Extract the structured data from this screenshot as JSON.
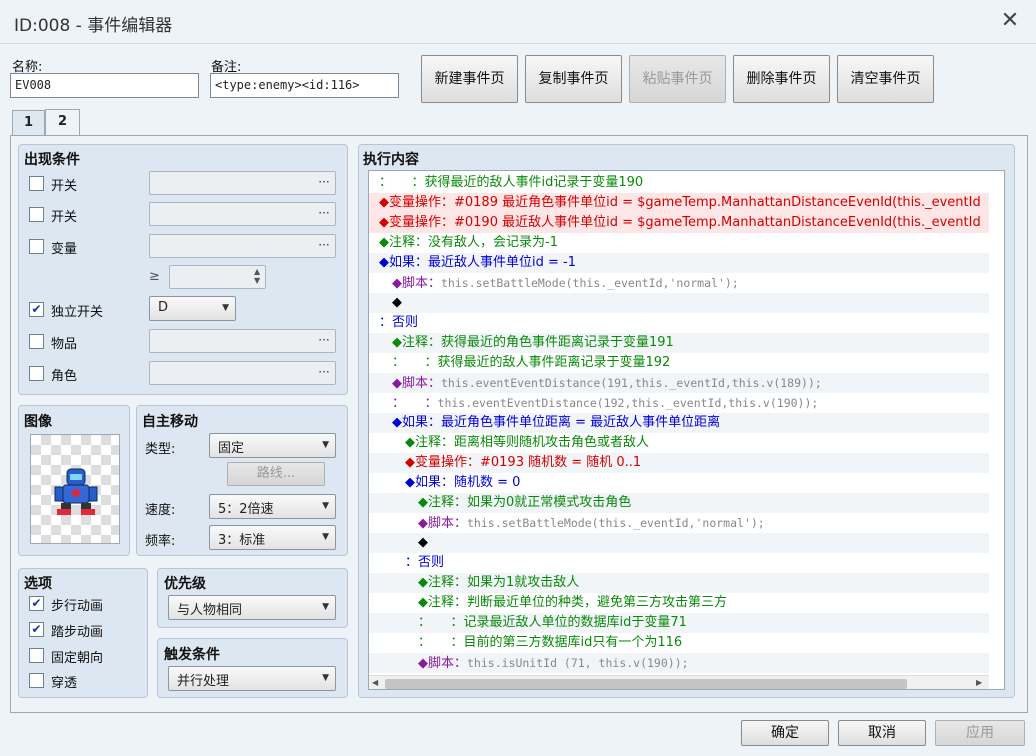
{
  "window": {
    "title": "ID:008 - 事件编辑器",
    "close_label": "✕"
  },
  "header": {
    "name_label": "名称:",
    "name_value": "EV008",
    "note_label": "备注:",
    "note_value": "<type:enemy><id:116>"
  },
  "page_buttons": {
    "new": "新建事件页",
    "copy": "复制事件页",
    "paste": "粘贴事件页",
    "delete": "删除事件页",
    "clear": "清空事件页"
  },
  "tabs": [
    "1",
    "2"
  ],
  "conditions": {
    "title": "出现条件",
    "switch1": {
      "label": "开关",
      "checked": false
    },
    "switch2": {
      "label": "开关",
      "checked": false
    },
    "variable": {
      "label": "变量",
      "checked": false,
      "ge": "≥"
    },
    "self_switch": {
      "label": "独立开关",
      "checked": true,
      "value": "D"
    },
    "item": {
      "label": "物品",
      "checked": false
    },
    "actor": {
      "label": "角色",
      "checked": false
    },
    "dots": "···"
  },
  "image": {
    "title": "图像"
  },
  "autonomous": {
    "title": "自主移动",
    "type_label": "类型:",
    "type_value": "固定",
    "route_button": "路线...",
    "speed_label": "速度:",
    "speed_value": "5：2倍速",
    "freq_label": "频率:",
    "freq_value": "3：标准"
  },
  "options": {
    "title": "选项",
    "items": [
      {
        "label": "步行动画",
        "checked": true
      },
      {
        "label": "踏步动画",
        "checked": true
      },
      {
        "label": "固定朝向",
        "checked": false
      },
      {
        "label": "穿透",
        "checked": false
      }
    ]
  },
  "priority": {
    "title": "优先级",
    "value": "与人物相同"
  },
  "trigger": {
    "title": "触发条件",
    "value": "并行处理"
  },
  "contents": {
    "title": "执行内容",
    "lines": [
      {
        "text": "：　　：获得最近的敌人事件id记录于变量190",
        "color": "green",
        "indent": 0,
        "alt": false,
        "red": false
      },
      {
        "text": "◆变量操作：#0189 最近角色事件单位id = $gameTemp.ManhattanDistanceEvenId(this._eventId",
        "color": "red",
        "indent": 0,
        "alt": false,
        "red": true
      },
      {
        "text": "◆变量操作：#0190 最近敌人事件单位id = $gameTemp.ManhattanDistanceEvenId(this._eventId",
        "color": "red",
        "indent": 0,
        "alt": false,
        "red": true
      },
      {
        "text": "◆注释：没有敌人，会记录为-1",
        "color": "green",
        "indent": 0,
        "alt": false,
        "red": false
      },
      {
        "text": "◆如果：最近敌人事件单位id = -1",
        "color": "blue",
        "indent": 0,
        "alt": true,
        "red": false
      },
      {
        "text": "◆脚本：",
        "extra": "this.setBattleMode(this._eventId,'normal');",
        "color": "purple",
        "indent": 1,
        "alt": false,
        "red": false
      },
      {
        "text": "◆",
        "color": "black",
        "indent": 1,
        "alt": true,
        "red": false
      },
      {
        "text": "：否则",
        "color": "blue",
        "indent": 0,
        "alt": false,
        "red": false
      },
      {
        "text": "◆注释：获得最近的角色事件距离记录于变量191",
        "color": "green",
        "indent": 1,
        "alt": true,
        "red": false
      },
      {
        "text": "：　　：获得最近的敌人事件距离记录于变量192",
        "color": "green",
        "indent": 1,
        "alt": false,
        "red": false
      },
      {
        "text": "◆脚本：",
        "extra": "this.eventEventDistance(191,this._eventId,this.v(189));",
        "color": "purple",
        "indent": 1,
        "alt": true,
        "red": false
      },
      {
        "text": "：　　：",
        "extra": "this.eventEventDistance(192,this._eventId,this.v(190));",
        "color": "purple",
        "indent": 1,
        "alt": false,
        "red": false
      },
      {
        "text": "◆如果：最近角色事件单位距离 = 最近敌人事件单位距离",
        "color": "blue",
        "indent": 1,
        "alt": true,
        "red": false
      },
      {
        "text": "◆注释：距离相等则随机攻击角色或者敌人",
        "color": "green",
        "indent": 2,
        "alt": false,
        "red": false
      },
      {
        "text": "◆变量操作：#0193 随机数 = 随机 0..1",
        "color": "red",
        "indent": 2,
        "alt": true,
        "red": false
      },
      {
        "text": "◆如果：随机数 = 0",
        "color": "blue",
        "indent": 2,
        "alt": false,
        "red": false
      },
      {
        "text": "◆注释：如果为0就正常模式攻击角色",
        "color": "green",
        "indent": 3,
        "alt": true,
        "red": false
      },
      {
        "text": "◆脚本：",
        "extra": "this.setBattleMode(this._eventId,'normal');",
        "color": "purple",
        "indent": 3,
        "alt": false,
        "red": false
      },
      {
        "text": "◆",
        "color": "black",
        "indent": 3,
        "alt": true,
        "red": false
      },
      {
        "text": "：否则",
        "color": "blue",
        "indent": 2,
        "alt": false,
        "red": false
      },
      {
        "text": "◆注释：如果为1就攻击敌人",
        "color": "green",
        "indent": 3,
        "alt": true,
        "red": false
      },
      {
        "text": "◆注释：判断最近单位的种类，避免第三方攻击第三方",
        "color": "green",
        "indent": 3,
        "alt": false,
        "red": false
      },
      {
        "text": "：　　：记录最近敌人单位的数据库id于变量71",
        "color": "green",
        "indent": 3,
        "alt": true,
        "red": false
      },
      {
        "text": "：　　：目前的第三方数据库id只有一个为116",
        "color": "green",
        "indent": 3,
        "alt": false,
        "red": false
      },
      {
        "text": "◆脚本：",
        "extra": "this.isUnitId (71, this.v(190));",
        "color": "purple",
        "indent": 3,
        "alt": true,
        "red": false
      }
    ]
  },
  "footer": {
    "ok": "确定",
    "cancel": "取消",
    "apply": "应用"
  }
}
